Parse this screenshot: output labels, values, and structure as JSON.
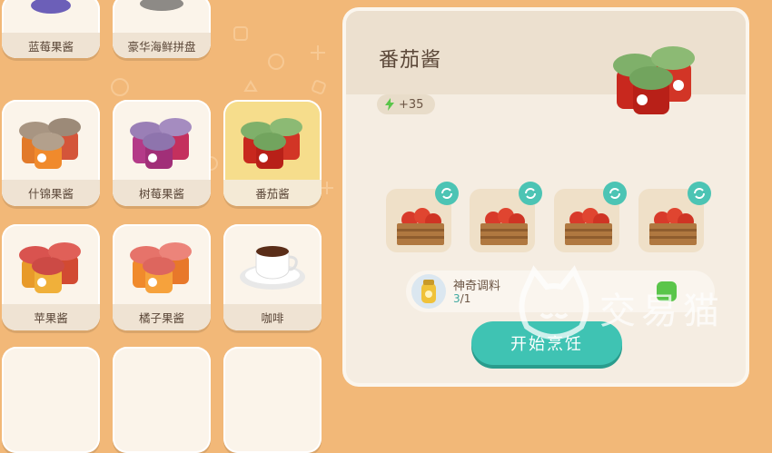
{
  "recipes": [
    {
      "label": "蓝莓果酱",
      "icon": "blueberry-jam-icon"
    },
    {
      "label": "豪华海鲜拼盘",
      "icon": "seafood-platter-icon"
    },
    {
      "label": "什锦果酱",
      "icon": "mixed-fruit-jam-icon"
    },
    {
      "label": "树莓果酱",
      "icon": "raspberry-jam-icon"
    },
    {
      "label": "番茄酱",
      "icon": "tomato-sauce-icon"
    },
    {
      "label": "苹果酱",
      "icon": "apple-jam-icon"
    },
    {
      "label": "橘子果酱",
      "icon": "orange-jam-icon"
    },
    {
      "label": "咖啡",
      "icon": "coffee-icon"
    }
  ],
  "detail": {
    "title": "番茄酱",
    "energy": "+35",
    "ingredients": [
      {
        "icon": "tomato-crate-icon"
      },
      {
        "icon": "tomato-crate-icon"
      },
      {
        "icon": "tomato-crate-icon"
      },
      {
        "icon": "tomato-crate-icon"
      }
    ],
    "seasoning": {
      "name": "神奇调料",
      "have": "3",
      "need": "1"
    },
    "cook_label": "开始烹饪"
  },
  "watermark": "交易猫",
  "colors": {
    "accent": "#3fc3b3",
    "background": "#f2b878",
    "selected": "#f6dd8c"
  }
}
